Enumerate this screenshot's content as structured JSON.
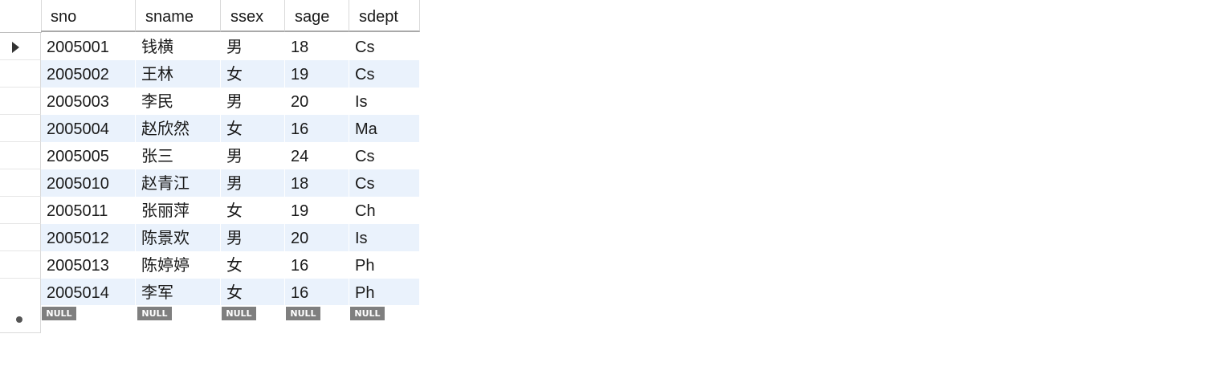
{
  "columns": [
    {
      "label": "sno"
    },
    {
      "label": "sname"
    },
    {
      "label": "ssex"
    },
    {
      "label": "sage"
    },
    {
      "label": "sdept"
    }
  ],
  "rows": [
    {
      "sno": "2005001",
      "sname": "钱横",
      "ssex": "男",
      "sage": "18",
      "sdept": "Cs"
    },
    {
      "sno": "2005002",
      "sname": "王林",
      "ssex": "女",
      "sage": "19",
      "sdept": "Cs"
    },
    {
      "sno": "2005003",
      "sname": "李民",
      "ssex": "男",
      "sage": "20",
      "sdept": "Is"
    },
    {
      "sno": "2005004",
      "sname": "赵欣然",
      "ssex": "女",
      "sage": "16",
      "sdept": "Ma"
    },
    {
      "sno": "2005005",
      "sname": "张三",
      "ssex": "男",
      "sage": "24",
      "sdept": "Cs"
    },
    {
      "sno": "2005010",
      "sname": "赵青江",
      "ssex": "男",
      "sage": "18",
      "sdept": "Cs"
    },
    {
      "sno": "2005011",
      "sname": "张丽萍",
      "ssex": "女",
      "sage": "19",
      "sdept": "Ch"
    },
    {
      "sno": "2005012",
      "sname": "陈景欢",
      "ssex": "男",
      "sage": "20",
      "sdept": "Is"
    },
    {
      "sno": "2005013",
      "sname": "陈婷婷",
      "ssex": "女",
      "sage": "16",
      "sdept": "Ph"
    },
    {
      "sno": "2005014",
      "sname": "李军",
      "ssex": "女",
      "sage": "16",
      "sdept": "Ph"
    }
  ],
  "new_row": {
    "null_label": "NULL"
  },
  "icons": {
    "current_row": "current-row-arrow-icon",
    "new_row": "new-row-marker-icon"
  },
  "colors": {
    "alt_row": "#eaf2fc",
    "null_badge": "#7f7f7f"
  }
}
